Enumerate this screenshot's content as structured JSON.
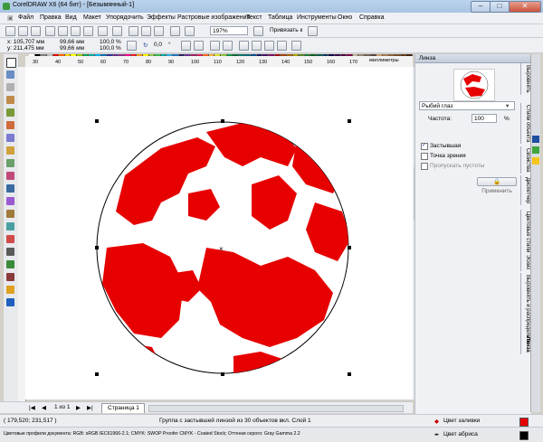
{
  "window": {
    "title": "CorelDRAW X6 (64 бит) - [Безымянный-1]",
    "minimize": "–",
    "maximize": "□",
    "close": "✕"
  },
  "menu": [
    "Файл",
    "Правка",
    "Вид",
    "Макет",
    "Упорядочить",
    "Эффекты",
    "Растровые изображения",
    "Текст",
    "Таблица",
    "Инструменты",
    "Окно",
    "Справка"
  ],
  "toolbar1": {
    "zoom": "197%",
    "snap": "Привязать к"
  },
  "propertybar": {
    "x": "x: 105,707 мм",
    "y": "y: 211,475 мм",
    "w": "99,66 мм",
    "h": "99,66 мм",
    "scale_w": "100,0",
    "scale_h": "100,0",
    "scale_unit": "%",
    "angle": "0,0",
    "angle_unit": "°"
  },
  "ruler_h": [
    "30",
    "40",
    "50",
    "60",
    "70",
    "80",
    "90",
    "100",
    "110",
    "120",
    "130",
    "140",
    "150",
    "160",
    "170"
  ],
  "ruler_unit": "миллиметры",
  "docker": {
    "title": "Линза",
    "lens_type": "Рыбий глаз",
    "rate_label": "Частота:",
    "rate_value": "100",
    "rate_unit": "%",
    "frozen": "Застывшая",
    "viewpoint": "Точка зрения",
    "remove_face": "Пропускать пустоты",
    "apply": "Применить"
  },
  "side_tabs": [
    "Выровнять",
    "Стили объекта",
    "Свойства",
    "Диспетчер",
    "Цветовые стили",
    "Эскиз",
    "Выровнять и распределить",
    "Линза"
  ],
  "pages": {
    "counter": "1 из 1",
    "tab": "Страница 1"
  },
  "status": {
    "coords": "( 179,520; 231,517 )",
    "info": "Группа с застывшей линзой из 30 объектов вкл. Слой 1",
    "fill_label": "Цвет заливки",
    "outline_label": "Цвет абриса",
    "profile": "Цветовые профили документа: RGB: sRGB IEC61966-2.1; CMYK: SWOP Proofer CMYK - Coated Stock; Оттенки серого: Gray Gamma 2.2"
  },
  "colors": {
    "accent_red": "#e60000",
    "canvas": "#ffffff"
  },
  "palette_colors": [
    "#ffffff",
    "#000000",
    "#7f7f7f",
    "#bfbfbf",
    "#e60000",
    "#ff6600",
    "#ffcc00",
    "#ffff00",
    "#99cc00",
    "#00a651",
    "#00a99d",
    "#00aeef",
    "#0072bc",
    "#2e3192",
    "#662d91",
    "#92278f",
    "#ec008c",
    "#ed1c24",
    "#f7941d",
    "#fff200",
    "#8dc63f",
    "#39b54a",
    "#00a99d",
    "#27aae1",
    "#1c75bc",
    "#262262",
    "#652d90",
    "#9e1f63",
    "#da1c5c",
    "#f26522",
    "#fbb040",
    "#d7df23",
    "#8cc63e",
    "#009444",
    "#006838",
    "#00746b",
    "#006b7a",
    "#004e8c",
    "#1b1464",
    "#440e62",
    "#790e68",
    "#9e0b0f",
    "#a0410d",
    "#a36209",
    "#aba000",
    "#598527",
    "#197b30",
    "#005e20",
    "#005952",
    "#003663",
    "#0d004c",
    "#32004b",
    "#4b0049",
    "#7b0046",
    "#c7b299",
    "#998675",
    "#736357",
    "#534741",
    "#c69c6d",
    "#a67c52",
    "#8c6239",
    "#754c24",
    "#603913",
    "#42210b"
  ]
}
